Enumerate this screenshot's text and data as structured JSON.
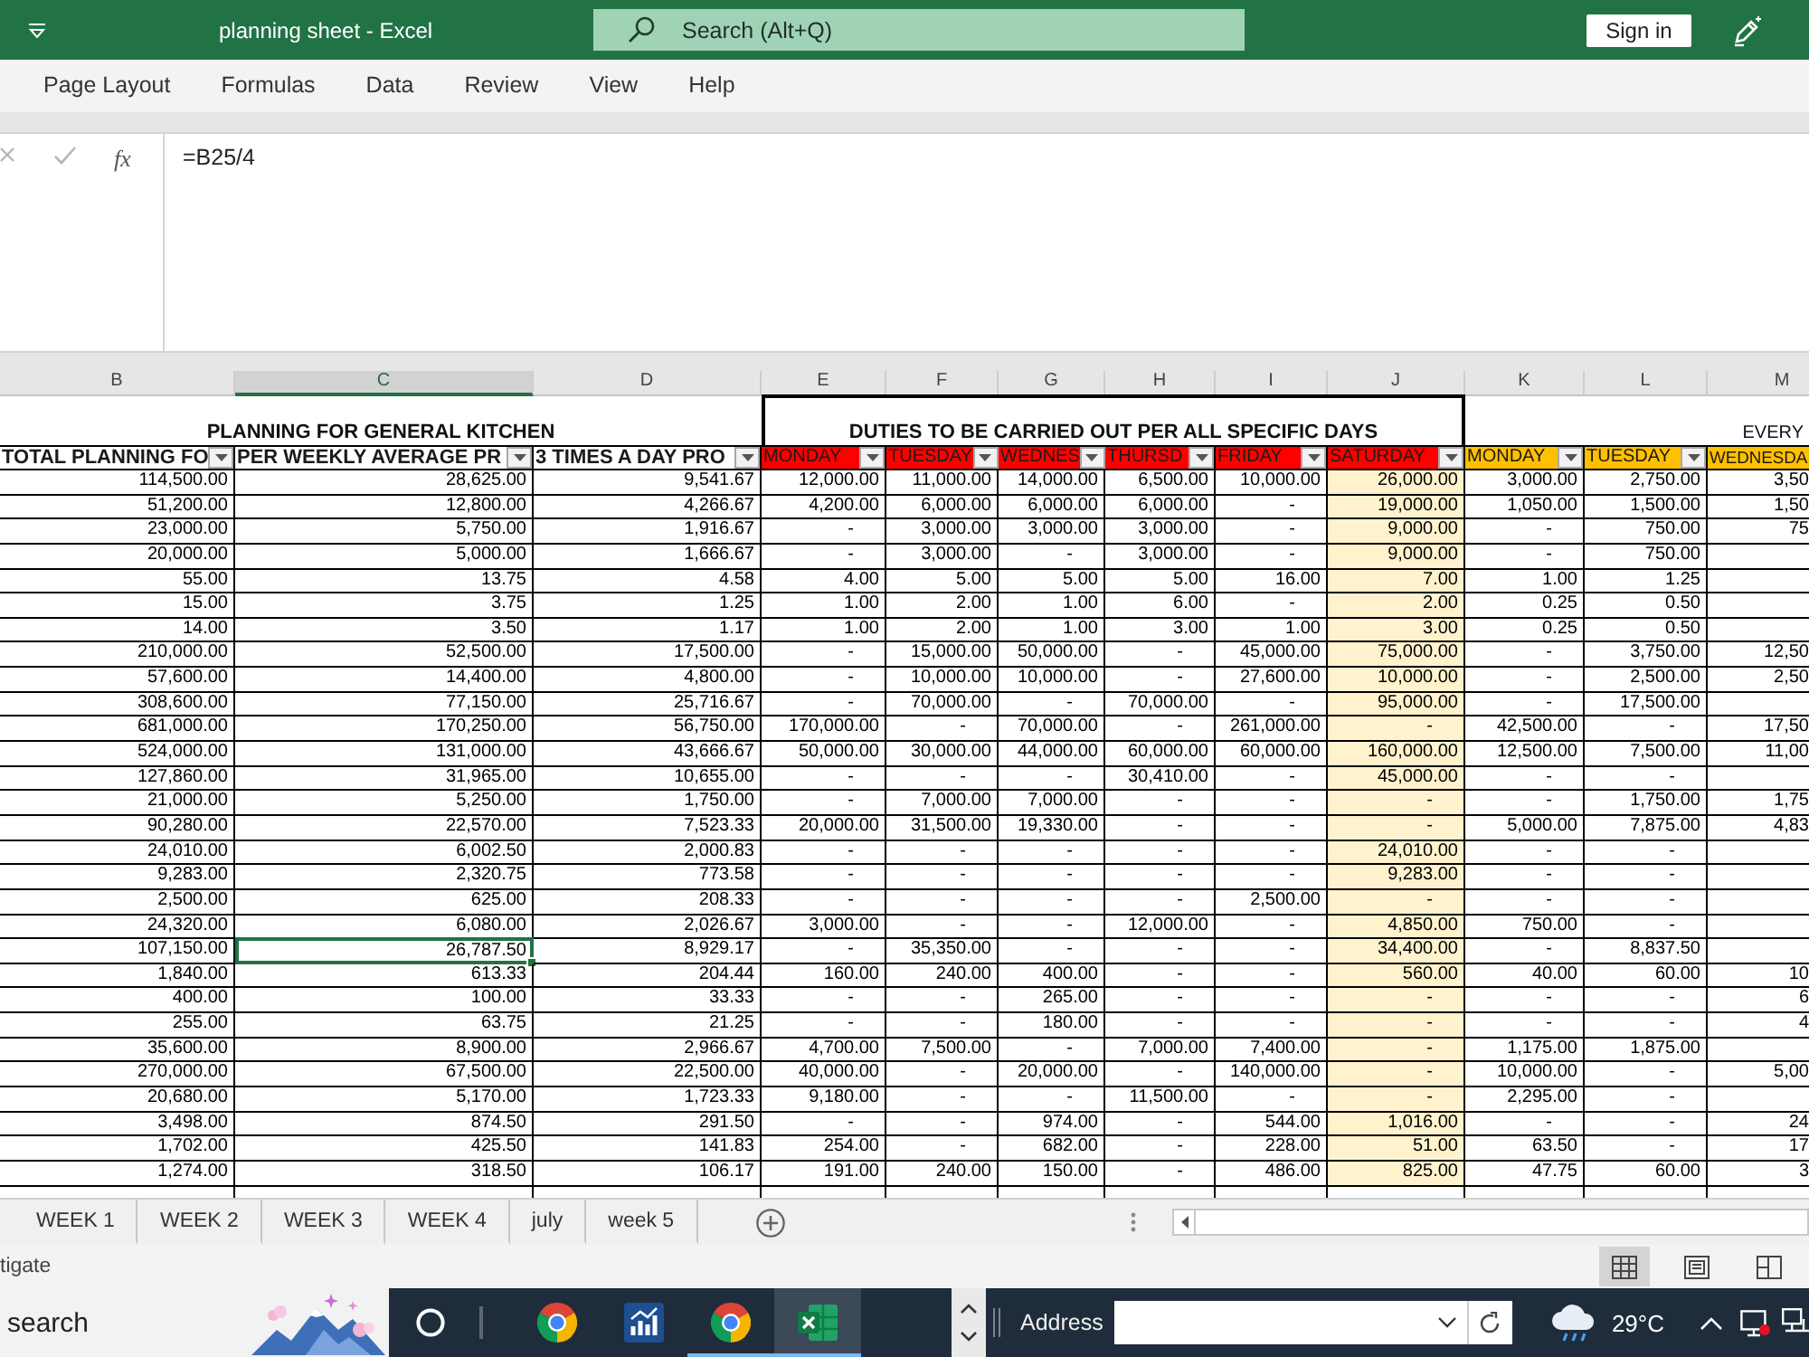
{
  "title_bar": {
    "title": "planning sheet - Excel",
    "search": {
      "placeholder": "Search (Alt+Q)"
    },
    "sign_in": "Sign in"
  },
  "ribbon_tabs": [
    {
      "label": "Page Layout",
      "selected": false
    },
    {
      "label": "Formulas",
      "selected": false
    },
    {
      "label": "Data",
      "selected": false
    },
    {
      "label": "Review",
      "selected": false
    },
    {
      "label": "View",
      "selected": false
    },
    {
      "label": "Help",
      "selected": false
    }
  ],
  "formula_bar": {
    "function_label": "fx",
    "formula": "=B25/4"
  },
  "sheet": {
    "columns": [
      {
        "letter": "B",
        "selected": false,
        "shaded": false
      },
      {
        "letter": "C",
        "selected": true,
        "shaded": false
      },
      {
        "letter": "D",
        "selected": false,
        "shaded": false
      },
      {
        "letter": "E",
        "selected": false,
        "shaded": false
      },
      {
        "letter": "F",
        "selected": false,
        "shaded": false
      },
      {
        "letter": "G",
        "selected": false,
        "shaded": false
      },
      {
        "letter": "H",
        "selected": false,
        "shaded": false
      },
      {
        "letter": "I",
        "selected": false,
        "shaded": false
      },
      {
        "letter": "J",
        "selected": false,
        "shaded": true
      },
      {
        "letter": "K",
        "selected": false,
        "shaded": false
      },
      {
        "letter": "L",
        "selected": false,
        "shaded": false
      },
      {
        "letter": "M",
        "selected": false,
        "shaded": false
      }
    ],
    "banners": [
      {
        "kind": "plain",
        "bold": true,
        "text": "PLANNING FOR GENERAL KITCHEN"
      },
      {
        "kind": "boxed",
        "bold": true,
        "text": "DUTIES TO BE CARRIED OUT PER ALL SPECIFIC DAYS"
      },
      {
        "kind": "plain",
        "bold": false,
        "text": "EVERY"
      }
    ],
    "headers": [
      {
        "kind": "total",
        "label": "TOTAL PLANNING FO",
        "color": "#ffffff"
      },
      {
        "kind": "total",
        "label": "PER WEEKLY AVERAGE PR",
        "color": "#ffffff"
      },
      {
        "kind": "total",
        "label": "3 TIMES A DAY PRO",
        "color": "#ffffff"
      },
      {
        "kind": "day",
        "label": "MONDAY",
        "color": "#ff0000"
      },
      {
        "kind": "day",
        "label": "TUESDAY",
        "color": "#ff0000"
      },
      {
        "kind": "day",
        "label": "WEDNES",
        "color": "#ff0000"
      },
      {
        "kind": "day",
        "label": "THURSD",
        "color": "#ff0000"
      },
      {
        "kind": "day",
        "label": "FRIDAY",
        "color": "#ff0000"
      },
      {
        "kind": "day",
        "label": "SATURDAY",
        "color": "#ff0000"
      },
      {
        "kind": "day",
        "label": "MONDAY",
        "color": "#ffc000"
      },
      {
        "kind": "day",
        "label": "TUESDAY",
        "color": "#ffc000"
      },
      {
        "kind": "day",
        "label": "WEDNESDA",
        "color": "#ffc000"
      }
    ],
    "rows": [
      {
        "selected": false,
        "cells": [
          "114,500.00",
          "28,625.00",
          "9,541.67",
          "12,000.00",
          "11,000.00",
          "14,000.00",
          "6,500.00",
          "10,000.00",
          "26,000.00",
          "3,000.00",
          "2,750.00",
          "3,50"
        ]
      },
      {
        "selected": false,
        "cells": [
          "51,200.00",
          "12,800.00",
          "4,266.67",
          "4,200.00",
          "6,000.00",
          "6,000.00",
          "6,000.00",
          "-",
          "19,000.00",
          "1,050.00",
          "1,500.00",
          "1,50"
        ]
      },
      {
        "selected": false,
        "cells": [
          "23,000.00",
          "5,750.00",
          "1,916.67",
          "-",
          "3,000.00",
          "3,000.00",
          "3,000.00",
          "-",
          "9,000.00",
          "-",
          "750.00",
          "75"
        ]
      },
      {
        "selected": false,
        "cells": [
          "20,000.00",
          "5,000.00",
          "1,666.67",
          "-",
          "3,000.00",
          "-",
          "3,000.00",
          "-",
          "9,000.00",
          "-",
          "750.00"
        ]
      },
      {
        "selected": false,
        "cells": [
          "55.00",
          "13.75",
          "4.58",
          "4.00",
          "5.00",
          "5.00",
          "5.00",
          "16.00",
          "7.00",
          "1.00",
          "1.25"
        ]
      },
      {
        "selected": false,
        "cells": [
          "15.00",
          "3.75",
          "1.25",
          "1.00",
          "2.00",
          "1.00",
          "6.00",
          "-",
          "2.00",
          "0.25",
          "0.50"
        ]
      },
      {
        "selected": false,
        "cells": [
          "14.00",
          "3.50",
          "1.17",
          "1.00",
          "2.00",
          "1.00",
          "3.00",
          "1.00",
          "3.00",
          "0.25",
          "0.50"
        ]
      },
      {
        "selected": false,
        "cells": [
          "210,000.00",
          "52,500.00",
          "17,500.00",
          "-",
          "15,000.00",
          "50,000.00",
          "-",
          "45,000.00",
          "75,000.00",
          "-",
          "3,750.00",
          "12,50"
        ]
      },
      {
        "selected": false,
        "cells": [
          "57,600.00",
          "14,400.00",
          "4,800.00",
          "-",
          "10,000.00",
          "10,000.00",
          "-",
          "27,600.00",
          "10,000.00",
          "-",
          "2,500.00",
          "2,50"
        ]
      },
      {
        "selected": false,
        "cells": [
          "308,600.00",
          "77,150.00",
          "25,716.67",
          "-",
          "70,000.00",
          "-",
          "70,000.00",
          "-",
          "95,000.00",
          "-",
          "17,500.00"
        ]
      },
      {
        "selected": false,
        "cells": [
          "681,000.00",
          "170,250.00",
          "56,750.00",
          "170,000.00",
          "-",
          "70,000.00",
          "-",
          "261,000.00",
          "-",
          "42,500.00",
          "-",
          "17,50"
        ]
      },
      {
        "selected": false,
        "cells": [
          "524,000.00",
          "131,000.00",
          "43,666.67",
          "50,000.00",
          "30,000.00",
          "44,000.00",
          "60,000.00",
          "60,000.00",
          "160,000.00",
          "12,500.00",
          "7,500.00",
          "11,00"
        ]
      },
      {
        "selected": false,
        "cells": [
          "127,860.00",
          "31,965.00",
          "10,655.00",
          "-",
          "-",
          "-",
          "30,410.00",
          "-",
          "45,000.00",
          "-",
          "-"
        ]
      },
      {
        "selected": false,
        "cells": [
          "21,000.00",
          "5,250.00",
          "1,750.00",
          "-",
          "7,000.00",
          "7,000.00",
          "-",
          "-",
          "-",
          "-",
          "1,750.00",
          "1,75"
        ]
      },
      {
        "selected": false,
        "cells": [
          "90,280.00",
          "22,570.00",
          "7,523.33",
          "20,000.00",
          "31,500.00",
          "19,330.00",
          "-",
          "-",
          "-",
          "5,000.00",
          "7,875.00",
          "4,83"
        ]
      },
      {
        "selected": false,
        "cells": [
          "24,010.00",
          "6,002.50",
          "2,000.83",
          "-",
          "-",
          "-",
          "-",
          "-",
          "24,010.00",
          "-",
          "-"
        ]
      },
      {
        "selected": false,
        "cells": [
          "9,283.00",
          "2,320.75",
          "773.58",
          "-",
          "-",
          "-",
          "-",
          "-",
          "9,283.00",
          "-",
          "-"
        ]
      },
      {
        "selected": false,
        "cells": [
          "2,500.00",
          "625.00",
          "208.33",
          "-",
          "-",
          "-",
          "-",
          "2,500.00",
          "-",
          "-",
          "-"
        ]
      },
      {
        "selected": false,
        "cells": [
          "24,320.00",
          "6,080.00",
          "2,026.67",
          "3,000.00",
          "-",
          "-",
          "12,000.00",
          "-",
          "4,850.00",
          "750.00",
          "-"
        ]
      },
      {
        "selected": true,
        "cells": [
          "107,150.00",
          "26,787.50",
          "8,929.17",
          "-",
          "35,350.00",
          "-",
          "-",
          "-",
          "34,400.00",
          "-",
          "8,837.50"
        ]
      },
      {
        "selected": false,
        "cells": [
          "1,840.00",
          "613.33",
          "204.44",
          "160.00",
          "240.00",
          "400.00",
          "-",
          "-",
          "560.00",
          "40.00",
          "60.00",
          "10"
        ]
      },
      {
        "selected": false,
        "cells": [
          "400.00",
          "100.00",
          "33.33",
          "-",
          "-",
          "265.00",
          "-",
          "-",
          "-",
          "-",
          "-",
          "6"
        ]
      },
      {
        "selected": false,
        "cells": [
          "255.00",
          "63.75",
          "21.25",
          "-",
          "-",
          "180.00",
          "-",
          "-",
          "-",
          "-",
          "-",
          "4"
        ]
      },
      {
        "selected": false,
        "cells": [
          "35,600.00",
          "8,900.00",
          "2,966.67",
          "4,700.00",
          "7,500.00",
          "-",
          "7,000.00",
          "7,400.00",
          "-",
          "1,175.00",
          "1,875.00"
        ]
      },
      {
        "selected": false,
        "cells": [
          "270,000.00",
          "67,500.00",
          "22,500.00",
          "40,000.00",
          "-",
          "20,000.00",
          "-",
          "140,000.00",
          "-",
          "10,000.00",
          "-",
          "5,00"
        ]
      },
      {
        "selected": false,
        "cells": [
          "20,680.00",
          "5,170.00",
          "1,723.33",
          "9,180.00",
          "-",
          "-",
          "11,500.00",
          "-",
          "-",
          "2,295.00",
          "-"
        ]
      },
      {
        "selected": false,
        "cells": [
          "3,498.00",
          "874.50",
          "291.50",
          "-",
          "-",
          "974.00",
          "-",
          "544.00",
          "1,016.00",
          "-",
          "-",
          "24"
        ]
      },
      {
        "selected": false,
        "cells": [
          "1,702.00",
          "425.50",
          "141.83",
          "254.00",
          "-",
          "682.00",
          "-",
          "228.00",
          "51.00",
          "63.50",
          "-",
          "17"
        ]
      },
      {
        "selected": false,
        "cells": [
          "1,274.00",
          "318.50",
          "106.17",
          "191.00",
          "240.00",
          "150.00",
          "-",
          "486.00",
          "825.00",
          "47.75",
          "60.00",
          "3"
        ]
      }
    ]
  },
  "sheet_tabs": [
    {
      "label": "WEEK 1",
      "selected": false
    },
    {
      "label": "WEEK 2",
      "selected": false
    },
    {
      "label": "WEEK 3",
      "selected": false
    },
    {
      "label": "WEEK 4",
      "selected": false
    },
    {
      "label": "july",
      "selected": false
    },
    {
      "label": "week 5",
      "selected": false
    }
  ],
  "status_bar": {
    "message": "tigate",
    "views": [
      {
        "kind": "normal",
        "selected": true
      },
      {
        "kind": "page_layout",
        "selected": false
      },
      {
        "kind": "page_break",
        "selected": false
      }
    ]
  },
  "taskbar": {
    "search": {
      "placeholder": "search"
    },
    "apps": [
      {
        "kind": "browser",
        "running": false,
        "active": false
      },
      {
        "kind": "chart",
        "running": false,
        "active": false
      },
      {
        "kind": "browser",
        "running": true,
        "active": false
      },
      {
        "kind": "spreadsheet",
        "running": true,
        "active": true
      }
    ],
    "address_label": "Address",
    "temperature": "29°C"
  }
}
